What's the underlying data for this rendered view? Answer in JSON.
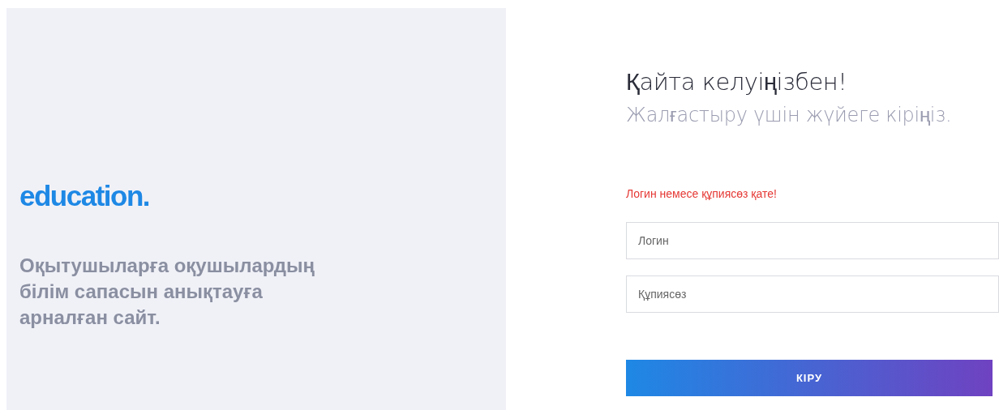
{
  "brand": {
    "logo": "education.",
    "tagline": "Оқытушыларға оқушылардың білім сапасын анықтауға арналған сайт."
  },
  "login": {
    "title": "Қайта келуіңізбен!",
    "subtitle": "Жалғастыру үшін жүйеге кіріңіз.",
    "error": "Логин немесе құпиясөз қате!",
    "fields": [
      {
        "placeholder": "Логин"
      },
      {
        "placeholder": "Құпиясөз"
      }
    ],
    "submit": "КІРУ"
  }
}
